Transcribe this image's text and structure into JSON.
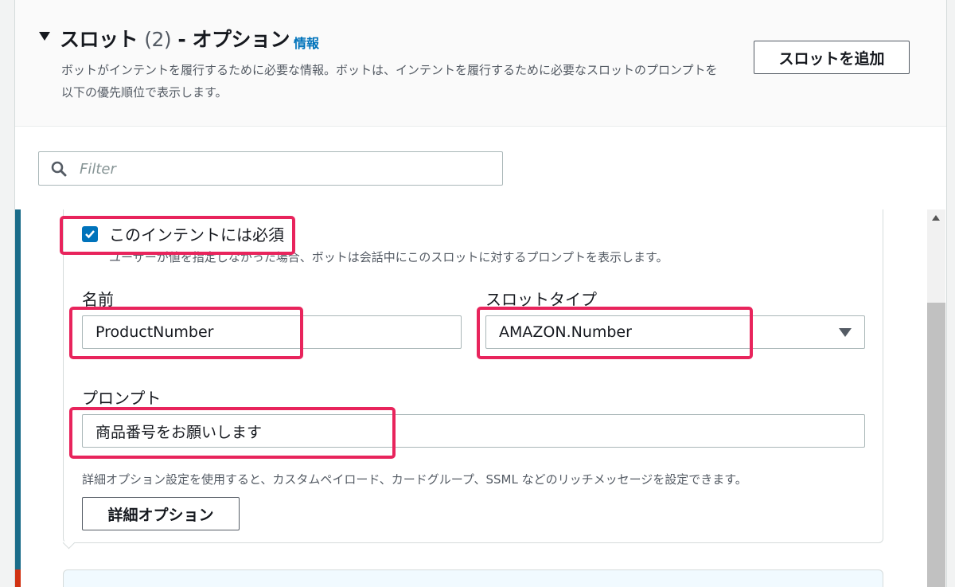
{
  "header": {
    "title_main": "スロット",
    "title_count": "(2)",
    "title_suffix": "- オプション",
    "info_link": "情報",
    "description": "ボットがインテントを履行するために必要な情報。ボットは、インテントを履行するために必要なスロットのプロンプトを以下の優先順位で表示します。",
    "add_slot_button": "スロットを追加"
  },
  "filter": {
    "placeholder": "Filter"
  },
  "slot": {
    "required_checked": true,
    "required_label": "このインテントには必須",
    "required_description": "ユーザーが値を指定しなかった場合、ボットは会話中にこのスロットに対するプロンプトを表示します。",
    "name_label": "名前",
    "name_value": "ProductNumber",
    "slot_type_label": "スロットタイプ",
    "slot_type_value": "AMAZON.Number",
    "prompt_label": "プロンプト",
    "prompt_value": "商品番号をお願いします",
    "advanced_hint": "詳細オプション設定を使用すると、カスタムペイロード、カードグループ、SSML などのリッチメッセージを設定できます。",
    "advanced_button": "詳細オプション"
  },
  "colors": {
    "accent_blue": "#0073bb",
    "highlight": "#e8245c",
    "slot_accent_bar": "#1b6c89",
    "next_slot_accent_bar": "#d13212"
  },
  "icons": [
    "caret-down-icon",
    "search-icon",
    "checkbox-checked-icon",
    "dropdown-arrow-icon",
    "scroll-up-icon"
  ]
}
